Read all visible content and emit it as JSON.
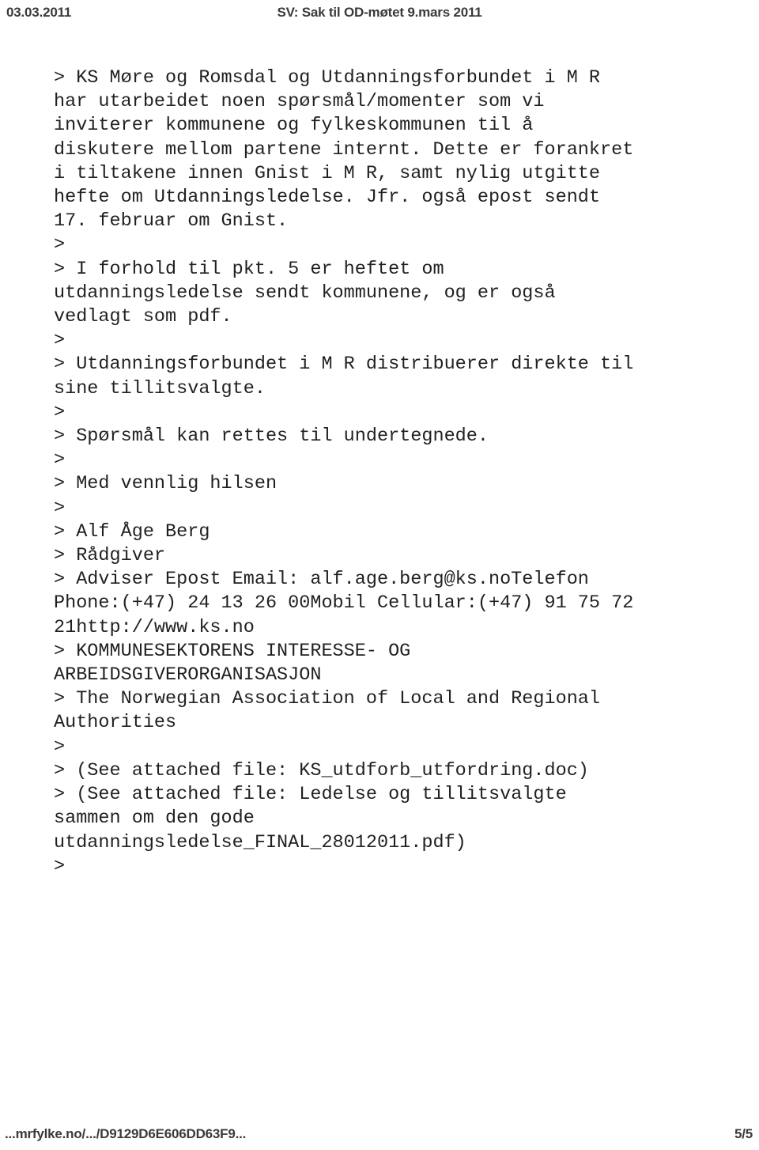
{
  "header": {
    "date": "03.03.2011",
    "title": "SV: Sak til OD-møtet 9.mars 2011"
  },
  "message": {
    "lines": [
      "> KS Møre og Romsdal og Utdanningsforbundet i M R",
      "har utarbeidet noen spørsmål/momenter som vi",
      "inviterer kommunene og fylkeskommunen til å",
      "diskutere mellom partene internt. Dette er forankret",
      "i tiltakene innen Gnist i M R, samt nylig utgitte",
      "hefte om Utdanningsledelse. Jfr. også epost sendt",
      "17. februar om Gnist.",
      ">",
      "> I forhold til pkt. 5 er heftet om",
      "utdanningsledelse sendt kommunene, og er også",
      "vedlagt som pdf.",
      ">",
      "> Utdanningsforbundet i M R distribuerer direkte til",
      "sine tillitsvalgte.",
      ">",
      "> Spørsmål kan rettes til undertegnede.",
      ">",
      "> Med vennlig hilsen",
      ">",
      "> Alf Åge Berg",
      "> Rådgiver",
      "> Adviser Epost Email: alf.age.berg@ks.noTelefon",
      "Phone:(+47) 24 13 26 00Mobil Cellular:(+47) 91 75 72",
      "21http://www.ks.no",
      "> KOMMUNESEKTORENS INTERESSE- OG",
      "ARBEIDSGIVERORGANISASJON",
      "> The Norwegian Association of Local and Regional",
      "Authorities",
      ">",
      "> (See attached file: KS_utdforb_utfordring.doc)",
      "> (See attached file: Ledelse og tillitsvalgte",
      "sammen om den gode",
      "utdanningsledelse_FINAL_28012011.pdf)",
      ">"
    ]
  },
  "footer": {
    "url": "...mrfylke.no/.../D9129D6E606DD63F9...",
    "page": "5/5"
  },
  "colors": {
    "text": "#231f20",
    "chrome_text": "#3a3a3a",
    "background": "#ffffff"
  }
}
